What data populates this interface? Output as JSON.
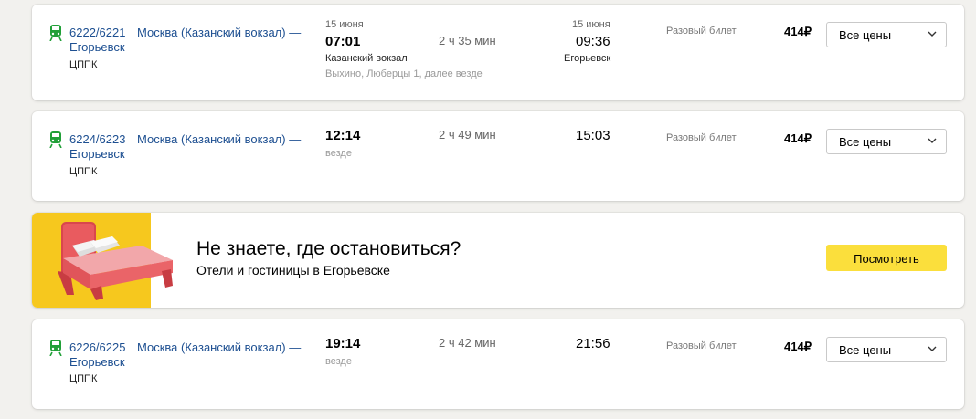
{
  "rows": [
    {
      "number": "6222/6221",
      "route": "Москва (Казанский вокзал) —",
      "destination": "Егорьевск",
      "carrier": "ЦППК",
      "dep_date": "15 июня",
      "dep_time": "07:01",
      "dep_station": "Казанский вокзал",
      "stops": "Выхино, Люберцы 1, далее везде",
      "duration": "2 ч 35 мин",
      "arr_date": "15 июня",
      "arr_time": "09:36",
      "arr_station": "Егорьевск",
      "ticket": "Разовый билет",
      "price": "414₽",
      "select": "Все цены"
    },
    {
      "number": "6224/6223",
      "route": "Москва (Казанский вокзал) —",
      "destination": "Егорьевск",
      "carrier": "ЦППК",
      "dep_time": "12:14",
      "stops": "везде",
      "duration": "2 ч 49 мин",
      "arr_time": "15:03",
      "ticket": "Разовый билет",
      "price": "414₽",
      "select": "Все цены"
    },
    {
      "number": "6226/6225",
      "route": "Москва (Казанский вокзал) —",
      "destination": "Егорьевск",
      "carrier": "ЦППК",
      "dep_time": "19:14",
      "stops": "везде",
      "duration": "2 ч 42 мин",
      "arr_time": "21:56",
      "ticket": "Разовый билет",
      "price": "414₽",
      "select": "Все цены"
    }
  ],
  "promo": {
    "title": "Не знаете, где остановиться?",
    "subtitle": "Отели и гостиницы в Егорьевске",
    "button": "Посмотреть"
  },
  "colors": {
    "link": "#1d4f91",
    "train_icon": "#21a038",
    "promo_yellow": "#f6c81e",
    "button_yellow": "#fbdf3c"
  },
  "icons": {
    "train": "train-icon",
    "chevron": "chevron-down-icon",
    "bed": "bed-illustration"
  }
}
